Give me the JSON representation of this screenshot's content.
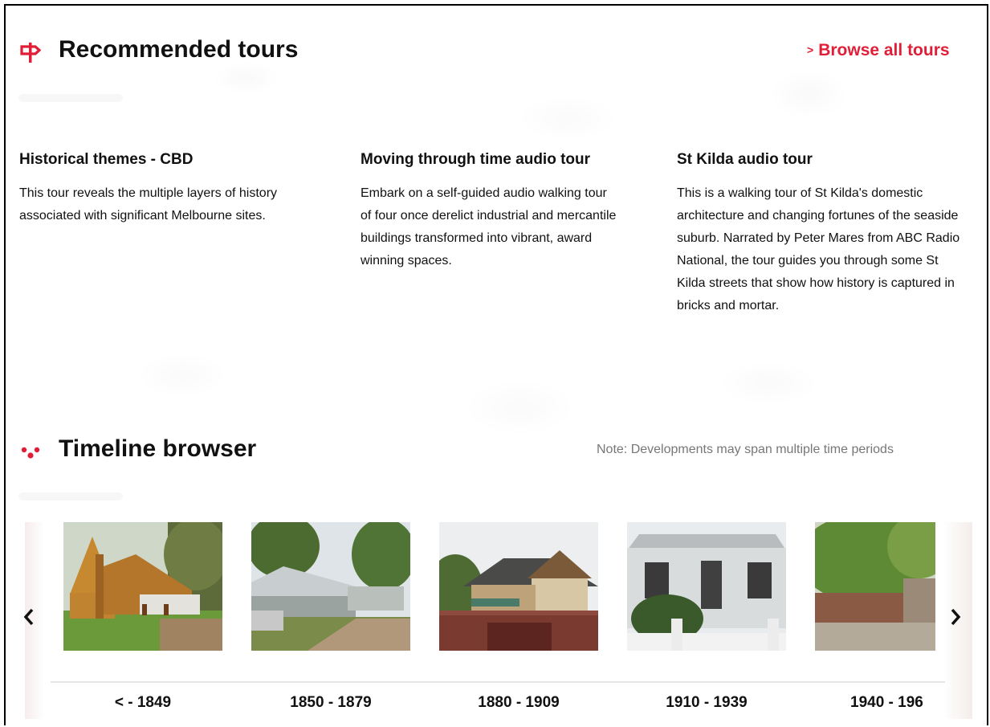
{
  "recommended": {
    "heading": "Recommended tours",
    "browse_label": "Browse all tours",
    "accent": "#e01e37",
    "icon": "signpost-icon"
  },
  "tours": [
    {
      "title": "Historical themes - CBD",
      "description": "This tour reveals the multiple layers of history associated with significant Melbourne sites."
    },
    {
      "title": "Moving through time audio tour",
      "description": "Embark on a self-guided audio walking tour of four once derelict industrial and mercantile buildings transformed into vibrant, award winning spaces."
    },
    {
      "title": "St Kilda audio tour",
      "description": "This is a walking tour of St Kilda's domestic architecture and changing fortunes of the seaside suburb. Narrated by Peter Mares from ABC Radio National, the tour guides you through some St Kilda streets that show how history is captured in bricks and mortar."
    }
  ],
  "timeline": {
    "heading": "Timeline browser",
    "note": "Note: Developments may span multiple time periods",
    "icon": "timeline-dots-icon",
    "prev_icon": "chevron-left-icon",
    "next_icon": "chevron-right-icon",
    "periods": [
      {
        "label": "< - 1849"
      },
      {
        "label": "1850 - 1879"
      },
      {
        "label": "1880 - 1909"
      },
      {
        "label": "1910 - 1939"
      },
      {
        "label": "1940 - 196"
      }
    ]
  }
}
